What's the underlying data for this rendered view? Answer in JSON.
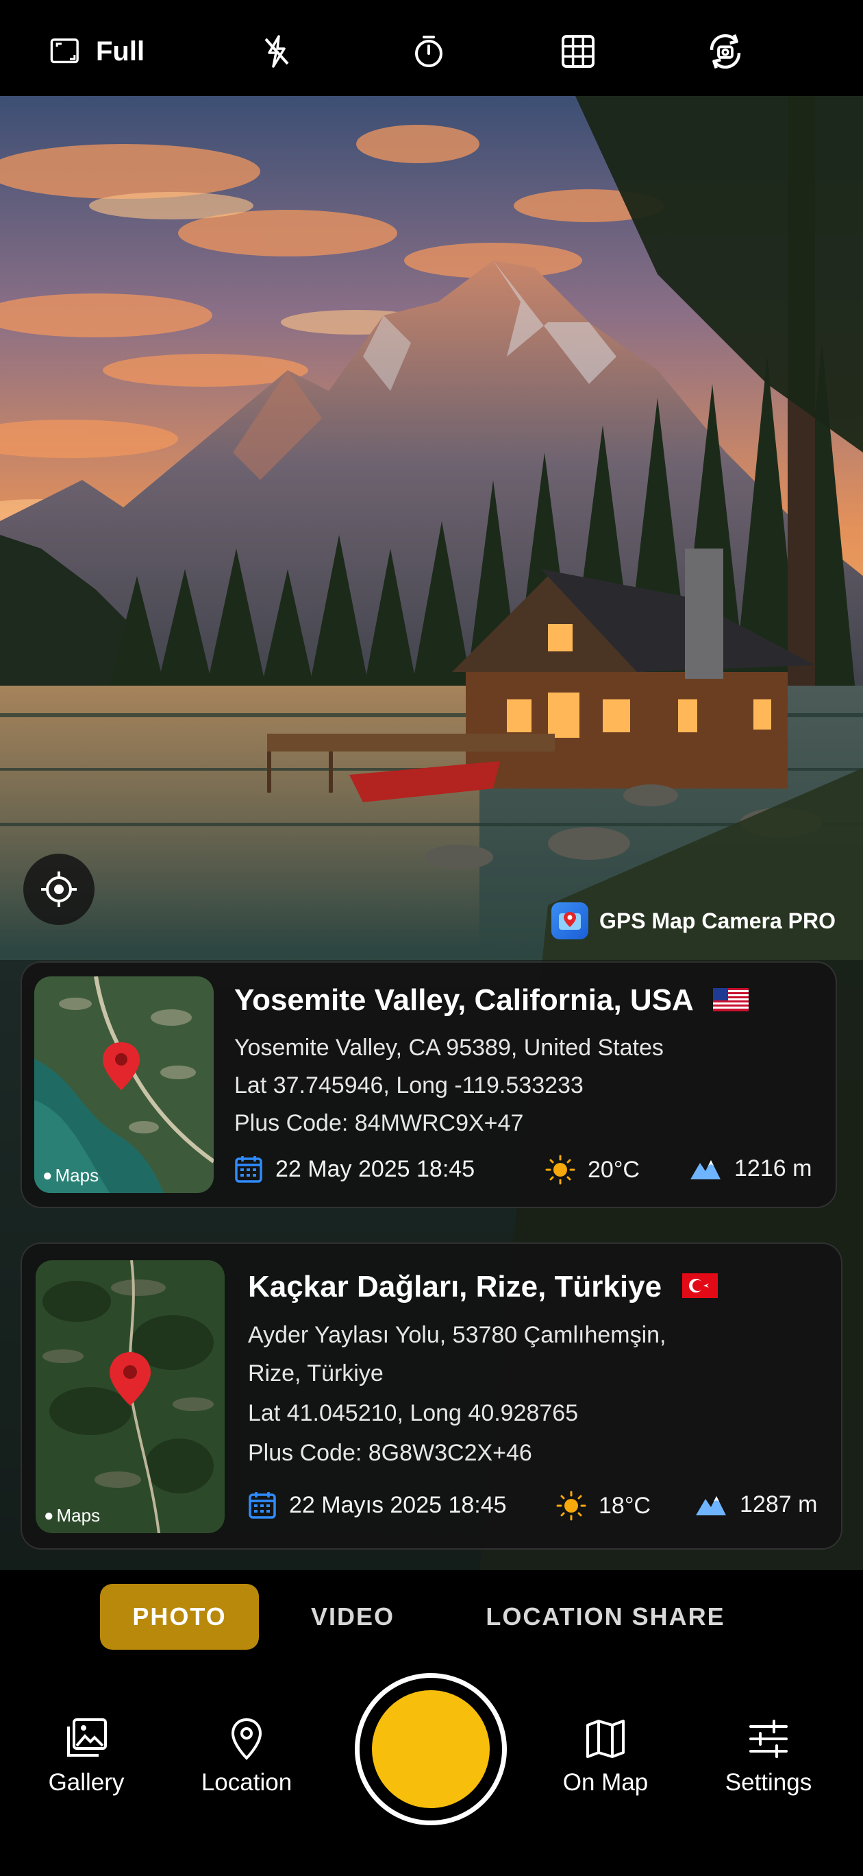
{
  "topbar": {
    "ratio_label": "Full",
    "icons": [
      "aspect-ratio-icon",
      "flash-off-icon",
      "timer-icon",
      "grid-icon",
      "switch-camera-icon"
    ]
  },
  "overlay": {
    "brand_name": "GPS Map Camera PRO"
  },
  "cards": [
    {
      "title": "Yosemite Valley, California, USA",
      "flag": "us",
      "address": "Yosemite Valley, CA 95389, United States",
      "coords": "Lat 37.745946, Long -119.533233",
      "plus_code": "Plus Code: 84MWRC9X+47",
      "date": "22 May 2025 18:45",
      "temp": "20°C",
      "altitude": "1216 m",
      "maps_label": "Maps"
    },
    {
      "title": "Kaçkar Dağları, Rize, Türkiye",
      "flag": "tr",
      "address_line1": "Ayder Yaylası Yolu, 53780 Çamlıhemşin,",
      "address_line2": "Rize, Türkiye",
      "coords": "Lat 41.045210, Long 40.928765",
      "plus_code": "Plus Code: 8G8W3C2X+46",
      "date": "22 Mayıs 2025 18:45",
      "temp": "18°C",
      "altitude": "1287 m",
      "maps_label": "Maps"
    }
  ],
  "modes": {
    "photo": "PHOTO",
    "video": "VIDEO",
    "location_share": "LOCATION SHARE",
    "active": "photo"
  },
  "bottom_nav": {
    "gallery": "Gallery",
    "location": "Location",
    "on_map": "On Map",
    "settings": "Settings"
  },
  "colors": {
    "accent": "#f7be0b",
    "active_mode_bg": "#b8890a",
    "icon_blue": "#2f8cff",
    "pin_red": "#e3262b"
  }
}
